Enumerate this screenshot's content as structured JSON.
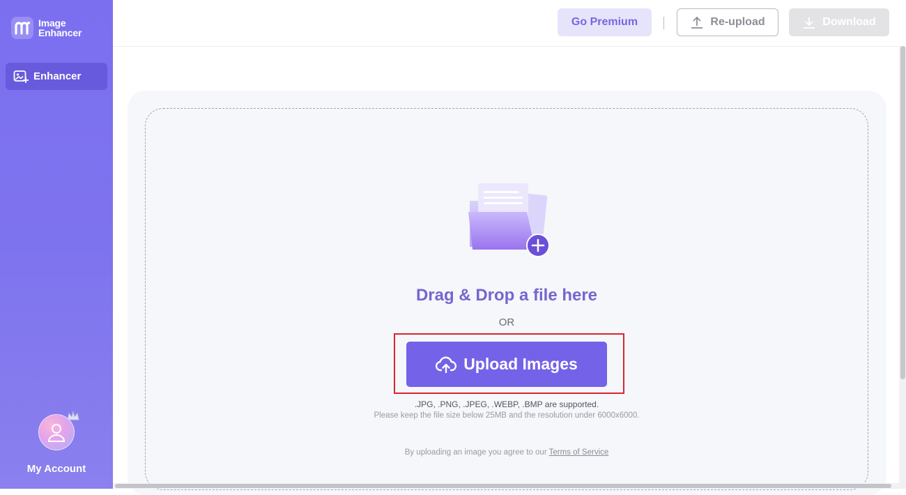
{
  "app": {
    "name_line1": "Image",
    "name_line2": "Enhancer",
    "brand_color": "#7b6ff0",
    "logo_icon": "m-logo-icon"
  },
  "sidebar": {
    "items": [
      {
        "label": "Enhancer",
        "icon": "image-enhance-icon",
        "active": true
      }
    ],
    "account": {
      "label": "My Account",
      "icon": "user-avatar-icon",
      "badge_icon": "crown-icon"
    }
  },
  "toolbar": {
    "premium_label": "Go Premium",
    "reupload_label": "Re-upload",
    "reupload_icon": "upload-arrow-icon",
    "download_label": "Download",
    "download_icon": "download-arrow-icon",
    "download_enabled": false
  },
  "dropzone": {
    "illustration": "folder-plus-icon",
    "title": "Drag & Drop a file here",
    "or_label": "OR",
    "upload_label": "Upload Images",
    "upload_icon": "cloud-upload-icon",
    "formats_text": ".JPG, .PNG, .JPEG, .WEBP, .BMP are supported.",
    "limits_text": "Please keep the file size below 25MB and the resolution under 6000x6000.",
    "terms_prefix": "By uploading an image you agree to our ",
    "terms_link": "Terms of Service",
    "highlight_color": "#d8262e"
  }
}
